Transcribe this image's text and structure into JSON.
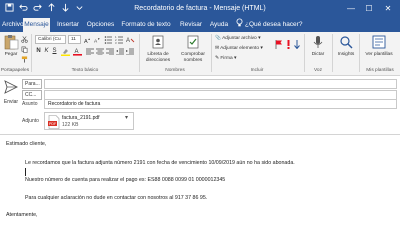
{
  "window": {
    "title": "Recordatorio de factura  -  Mensaje (HTML)",
    "controls": [
      "—",
      "☐",
      "✕"
    ]
  },
  "quick_access": {
    "save_icon": "save-icon",
    "undo_icon": "undo-icon",
    "redo_icon": "redo-icon",
    "up_icon": "arrow-up-icon",
    "down_icon": "arrow-down-icon",
    "more_icon": "more-icon"
  },
  "tabs": {
    "archivo": "Archivo",
    "mensaje": "Mensaje",
    "insertar": "Insertar",
    "opciones": "Opciones",
    "formato": "Formato de texto",
    "revisar": "Revisar",
    "ayuda": "Ayuda",
    "search": "¿Qué desea hacer?"
  },
  "ribbon": {
    "paste": "Pegar",
    "clipboard_group": "Portapapeles",
    "font_name": "Calibri (Cu",
    "font_size": "11",
    "text_group": "Texto básico",
    "address_book": "Libreta de direcciones",
    "check_names": "Comprobar nombres",
    "names_group": "Nombres",
    "attach_file": "Adjuntar archivo",
    "attach_item": "Adjuntar elemento",
    "signature": "Firma",
    "include_group": "Incluir",
    "dictate": "Dictar",
    "voice_group": "Voz",
    "insights": "Insights",
    "view_templates": "Ver plantillas",
    "templates_group": "Mis plantillas"
  },
  "header": {
    "send": "Enviar",
    "to_label": "Para...",
    "cc_label": "CC...",
    "to_value": "",
    "cc_value": "",
    "subject_label": "Asunto",
    "subject_value": "Recordatorio de factura",
    "attached_label": "Adjunto",
    "attachment_name": "factura_2191.pdf",
    "attachment_size": "122 KB"
  },
  "body": {
    "greeting": "Estimado cliente,",
    "line1": "Le recordamos que la factura adjunta número 2191 con fecha de vencimiento 10/09/2019 aún no ha sido abonada.",
    "line2": "Nuestro número de cuenta para realizar el pago es: ES88 0088 0099 01 0000012345",
    "line3": "Para cualquier aclaración no dude en contactar con nosotros al 917 37 86 95.",
    "closing": "Atentamente,"
  },
  "colors": {
    "titlebar": "#2b579a",
    "ribbon": "#f3f3f3",
    "pdf_icon": "#d93025"
  }
}
